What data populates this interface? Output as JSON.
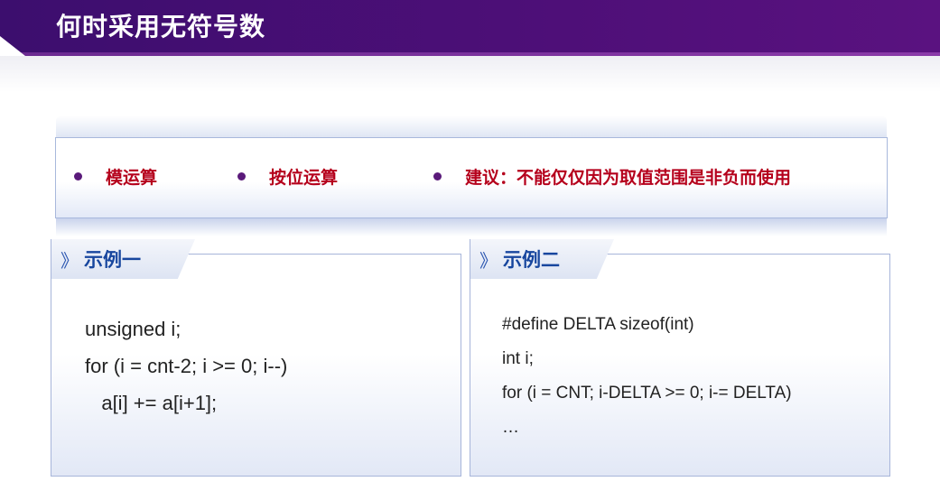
{
  "slide": {
    "title": "何时采用无符号数"
  },
  "bullets": [
    {
      "text": "模运算"
    },
    {
      "text": "按位运算"
    },
    {
      "text": "建议：不能仅仅因为取值范围是非负而使用"
    }
  ],
  "examples": [
    {
      "label": "示例一",
      "lines": [
        "unsigned i;",
        "for (i = cnt-2; i >= 0; i--)",
        "   a[i] += a[i+1];"
      ]
    },
    {
      "label": "示例二",
      "lines": [
        "#define DELTA sizeof(int)",
        "int i;",
        "for (i = CNT; i-DELTA >= 0; i-= DELTA)",
        "…"
      ]
    }
  ],
  "icons": {
    "tab_chevron": "double-chevron-right-icon",
    "bullet": "dot-icon"
  },
  "colors": {
    "title_bar": "#4e0f78",
    "bullet_text": "#b5001c",
    "tab_text": "#17469e"
  }
}
